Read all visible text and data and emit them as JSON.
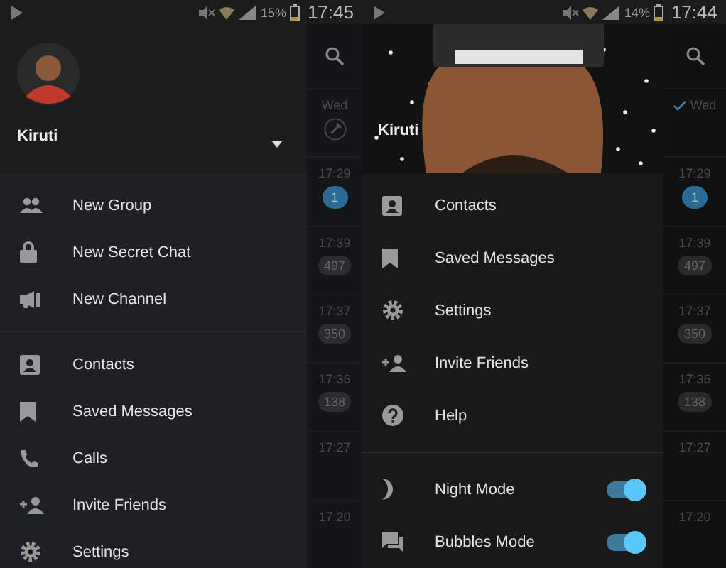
{
  "phones": [
    {
      "status_bar": {
        "battery": "15%",
        "time": "17:45"
      },
      "header": {
        "kind": "avatar",
        "name": "Kiruti"
      },
      "menu": [
        {
          "kind": "new-group",
          "label": "New Group"
        },
        {
          "kind": "secret-chat",
          "label": "New Secret Chat"
        },
        {
          "kind": "channel",
          "label": "New Channel"
        },
        {
          "kind": "divider"
        },
        {
          "kind": "contacts",
          "label": "Contacts"
        },
        {
          "kind": "saved",
          "label": "Saved Messages"
        },
        {
          "kind": "calls",
          "label": "Calls"
        },
        {
          "kind": "invite",
          "label": "Invite Friends"
        },
        {
          "kind": "settings",
          "label": "Settings"
        }
      ],
      "chat_list": [
        {
          "kind": "pinned",
          "time": "Wed"
        },
        {
          "kind": "plain",
          "time": "17:29",
          "badge": "1",
          "color": "#2b6a94"
        },
        {
          "kind": "plain",
          "time": "17:39",
          "badge": "497",
          "color": "#2a2c2e"
        },
        {
          "kind": "plain",
          "time": "17:37",
          "badge": "350",
          "color": "#2a2c2e"
        },
        {
          "kind": "plain",
          "time": "17:36",
          "badge": "138",
          "color": "#2a2c2e"
        },
        {
          "kind": "plain",
          "time": "17:27"
        },
        {
          "kind": "plain",
          "time": "17:20"
        }
      ]
    },
    {
      "status_bar": {
        "battery": "14%",
        "time": "17:44"
      },
      "header": {
        "kind": "picture",
        "name": "Kiruti"
      },
      "menu": [
        {
          "kind": "contacts",
          "label": "Contacts"
        },
        {
          "kind": "saved",
          "label": "Saved Messages"
        },
        {
          "kind": "settings",
          "label": "Settings"
        },
        {
          "kind": "invite",
          "label": "Invite Friends"
        },
        {
          "kind": "help",
          "label": "Help"
        },
        {
          "kind": "divider"
        },
        {
          "kind": "night",
          "label": "Night Mode",
          "on": true
        },
        {
          "kind": "bubbles",
          "label": "Bubbles Mode",
          "on": true
        }
      ],
      "chat_list": [
        {
          "kind": "read",
          "time": "Wed"
        },
        {
          "kind": "plain",
          "time": "17:29",
          "badge": "1",
          "color": "#2b6a94"
        },
        {
          "kind": "plain",
          "time": "17:39",
          "badge": "497",
          "color": "#2a2a2a"
        },
        {
          "kind": "plain",
          "time": "17:37",
          "badge": "350",
          "color": "#2a2a2a"
        },
        {
          "kind": "plain",
          "time": "17:36",
          "badge": "138",
          "color": "#2a2a2a"
        },
        {
          "kind": "plain",
          "time": "17:27"
        },
        {
          "kind": "plain",
          "time": "17:20"
        }
      ]
    }
  ]
}
